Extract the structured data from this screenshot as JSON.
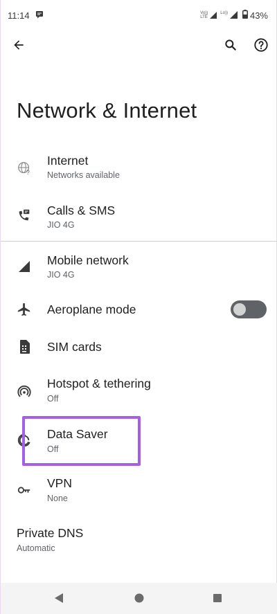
{
  "status_bar": {
    "time": "11:14",
    "network_top": "Vo))",
    "network_bottom": "LTE",
    "wifi_label": "Lo))",
    "battery": "43%",
    "icons": [
      "message-icon",
      "signal-icon",
      "battery-icon"
    ]
  },
  "header": {
    "back_icon": "arrow-back-icon",
    "search_icon": "search-icon",
    "help_icon": "help-icon",
    "title": "Network & Internet"
  },
  "items": [
    {
      "title": "Internet",
      "subtitle": "Networks available",
      "icon": "globe-icon"
    },
    {
      "title": "Calls & SMS",
      "subtitle": "JIO 4G",
      "icon": "calls-sms-icon"
    },
    {
      "title": "Mobile network",
      "subtitle": "JIO 4G",
      "icon": "signal-icon"
    },
    {
      "title": "Aeroplane mode",
      "subtitle": "",
      "icon": "airplane-icon",
      "toggle": false
    },
    {
      "title": "SIM cards",
      "subtitle": "",
      "icon": "sim-card-icon"
    },
    {
      "title": "Hotspot & tethering",
      "subtitle": "Off",
      "icon": "hotspot-icon"
    },
    {
      "title": "Data Saver",
      "subtitle": "Off",
      "icon": "data-saver-icon"
    },
    {
      "title": "VPN",
      "subtitle": "None",
      "icon": "vpn-key-icon"
    },
    {
      "title": "Private DNS",
      "subtitle": "Automatic",
      "icon": ""
    }
  ],
  "highlight_color": "#a55ee6",
  "nav": {
    "back": "nav-back-icon",
    "home": "nav-home-icon",
    "recents": "nav-recents-icon"
  }
}
